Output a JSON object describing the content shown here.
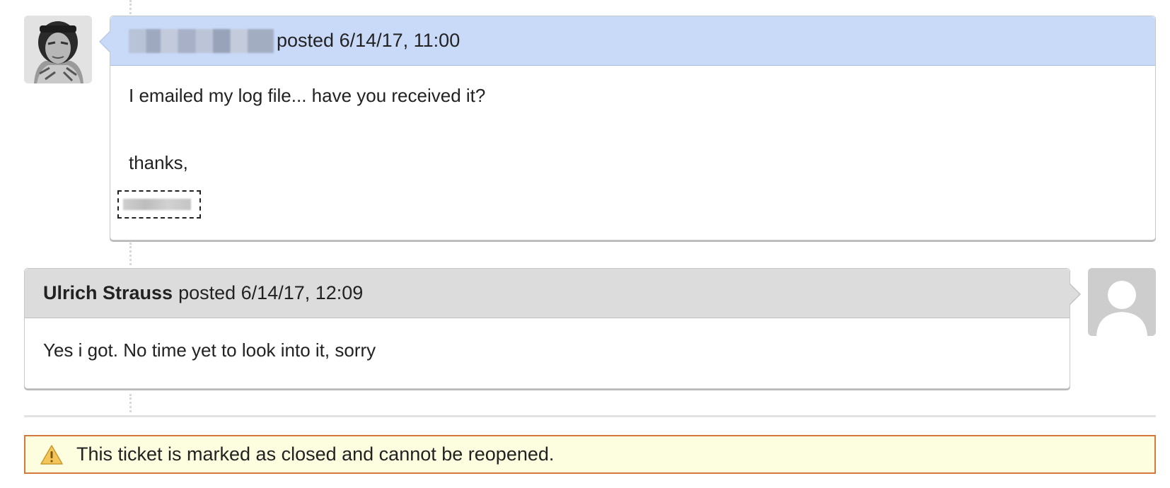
{
  "messages": [
    {
      "author": "",
      "posted_label": "posted 6/14/17, 11:00",
      "body_line1": "I emailed my log file... have you received it?",
      "body_line2": "thanks,",
      "avatar": "astronaut-photo-avatar"
    },
    {
      "author": "Ulrich Strauss",
      "posted_label": "posted 6/14/17, 12:09",
      "body_line1": "Yes i got. No time yet to look into it, sorry",
      "avatar": "default-user-avatar"
    }
  ],
  "notice": {
    "text": "This ticket is marked as closed and cannot be reopened.",
    "icon": "warning-icon"
  },
  "colors": {
    "header_blue": "#c9daf9",
    "header_gray": "#dcdcdc",
    "notice_bg": "#fdfde0",
    "notice_border": "#d4793d"
  }
}
